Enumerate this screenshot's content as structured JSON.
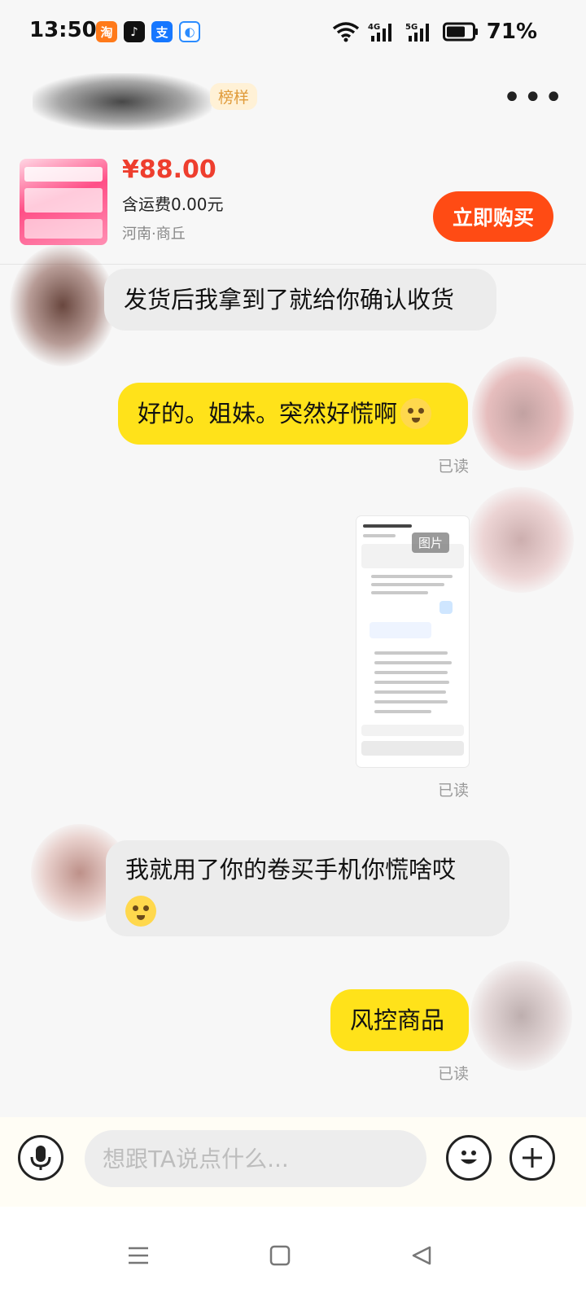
{
  "status_bar": {
    "time": "13:50",
    "battery": "71%",
    "app_icons": [
      "taobao-icon",
      "tiktok-icon",
      "alipay-icon",
      "browser-icon"
    ]
  },
  "header": {
    "name_tag": "榜样",
    "more_icon": "more-icon"
  },
  "product": {
    "price": "¥88.00",
    "shipping": "含运费0.00元",
    "location": "河南·商丘",
    "buy_label": "立即购买"
  },
  "messages": [
    {
      "side": "left",
      "text": "发货后我拿到了就给你确认收货"
    },
    {
      "side": "right",
      "text": "好的。姐妹。突然好慌啊",
      "read": "已读",
      "emoji": "tearful-emoji"
    },
    {
      "side": "right",
      "type": "image",
      "image_tag": "图片",
      "read": "已读"
    },
    {
      "side": "left",
      "text": "我就用了你的卷买手机你慌啥哎",
      "emoji": "crying-laughing-emoji"
    },
    {
      "side": "right",
      "text": "风控商品",
      "read": "已读"
    }
  ],
  "input": {
    "placeholder": "想跟TA说点什么..."
  },
  "colors": {
    "accent": "#ff4b14",
    "price": "#ee3e2e",
    "my_bubble": "#ffe21a",
    "their_bubble": "#ececec"
  }
}
